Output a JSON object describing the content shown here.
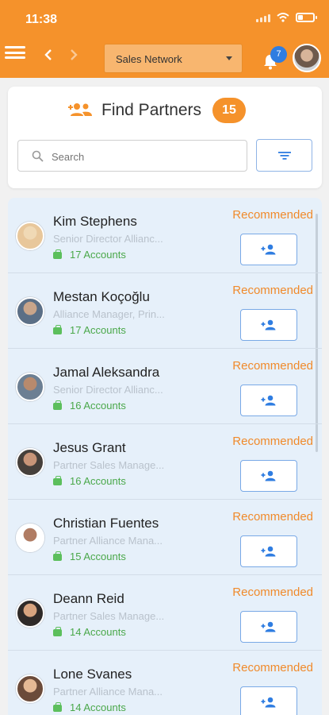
{
  "status_bar": {
    "time": "11:38"
  },
  "header": {
    "network_select": "Sales Network",
    "notifications_count": "7"
  },
  "finder": {
    "title": "Find Partners",
    "count": "15",
    "search_placeholder": "Search"
  },
  "colors": {
    "brand_orange": "#f5922b",
    "accent_blue": "#2f7de1",
    "recommended": "#f08a2b",
    "accounts_green": "#4aa84a",
    "list_bg": "#e6f0fa"
  },
  "partners": [
    {
      "name": "Kim Stephens",
      "title": "Senior Director Allianc...",
      "accounts": "17 Accounts",
      "recommended": "Recommended",
      "avatar_colors": [
        "#e8c79b",
        "#f0d9b5"
      ]
    },
    {
      "name": "Mestan Koçoğlu",
      "title": "Alliance Manager, Prin...",
      "accounts": "17 Accounts",
      "recommended": "Recommended",
      "avatar_colors": [
        "#5b6f86",
        "#c9a58a"
      ]
    },
    {
      "name": "Jamal Aleksandra",
      "title": "Senior Director Allianc...",
      "accounts": "16 Accounts",
      "recommended": "Recommended",
      "avatar_colors": [
        "#6c7f93",
        "#b88a6d"
      ]
    },
    {
      "name": "Jesus Grant",
      "title": "Partner Sales Manage...",
      "accounts": "16 Accounts",
      "recommended": "Recommended",
      "avatar_colors": [
        "#46403b",
        "#c89578"
      ]
    },
    {
      "name": "Christian Fuentes",
      "title": "Partner Alliance Mana...",
      "accounts": "15 Accounts",
      "recommended": "Recommended",
      "avatar_colors": [
        "#ffffff",
        "#b07c63"
      ]
    },
    {
      "name": "Deann Reid",
      "title": "Partner Sales Manage...",
      "accounts": "14 Accounts",
      "recommended": "Recommended",
      "avatar_colors": [
        "#2f2a28",
        "#d8a47f"
      ]
    },
    {
      "name": "Lone Svanes",
      "title": "Partner Alliance Mana...",
      "accounts": "14 Accounts",
      "recommended": "Recommended",
      "avatar_colors": [
        "#6b4b3a",
        "#e5b995"
      ]
    }
  ],
  "icons": {
    "menu": "menu-icon",
    "back": "chevron-left-icon",
    "forward": "chevron-right-icon",
    "bell": "bell-icon",
    "add_people": "add-users-icon",
    "search": "search-icon",
    "filter": "filter-icon",
    "add_partner": "add-user-icon",
    "briefcase": "briefcase-icon"
  }
}
